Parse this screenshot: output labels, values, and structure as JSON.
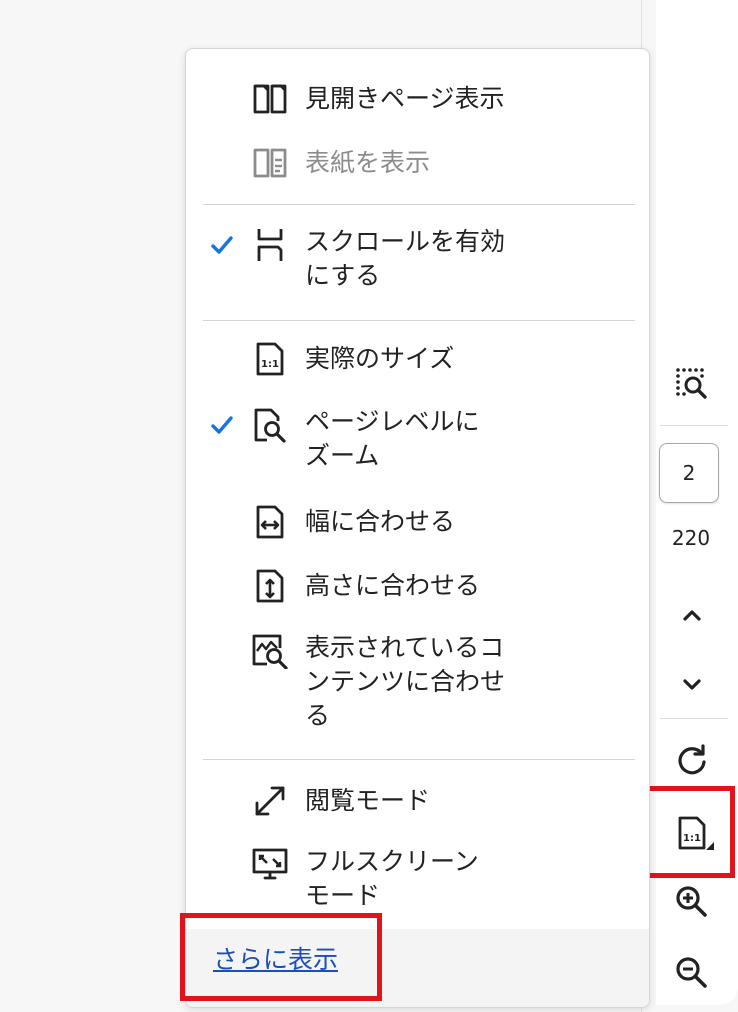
{
  "colors": {
    "accent": "#1473e6",
    "highlight": "#e0141b",
    "link": "#1a4fb8",
    "disabled_text": "#8c8c8c"
  },
  "menu": {
    "items": [
      {
        "id": "two-page",
        "label": "見開きページ表示",
        "icon": "two-page-icon",
        "checked": false,
        "enabled": true
      },
      {
        "id": "cover",
        "label": "表紙を表示",
        "icon": "cover-page-icon",
        "checked": false,
        "enabled": false
      },
      {
        "id": "scroll",
        "label": "スクロールを有効\nにする",
        "icon": "scroll-icon",
        "checked": true,
        "enabled": true
      },
      {
        "id": "actual-size",
        "label": "実際のサイズ",
        "icon": "actual-size-icon",
        "checked": false,
        "enabled": true
      },
      {
        "id": "zoom-page",
        "label": "ページレベルに\nズーム",
        "icon": "zoom-page-icon",
        "checked": true,
        "enabled": true
      },
      {
        "id": "fit-width",
        "label": "幅に合わせる",
        "icon": "fit-width-icon",
        "checked": false,
        "enabled": true
      },
      {
        "id": "fit-height",
        "label": "高さに合わせる",
        "icon": "fit-height-icon",
        "checked": false,
        "enabled": true
      },
      {
        "id": "fit-visible",
        "label": "表示されているコ\nンテンツに合わせ\nる",
        "icon": "fit-visible-icon",
        "checked": false,
        "enabled": true
      },
      {
        "id": "reading-mode",
        "label": "閲覧モード",
        "icon": "expand-arrows-icon",
        "checked": false,
        "enabled": true
      },
      {
        "id": "full-screen",
        "label": "フルスクリーン\nモード",
        "icon": "full-screen-icon",
        "checked": false,
        "enabled": true
      }
    ],
    "more_label": "さらに表示"
  },
  "toolbar": {
    "page_current": "2",
    "page_total": "220",
    "icons": [
      "marquee-zoom-icon",
      "chevron-up-icon",
      "chevron-down-icon",
      "rotate-icon",
      "page-display-icon",
      "zoom-in-icon",
      "zoom-out-icon"
    ]
  }
}
